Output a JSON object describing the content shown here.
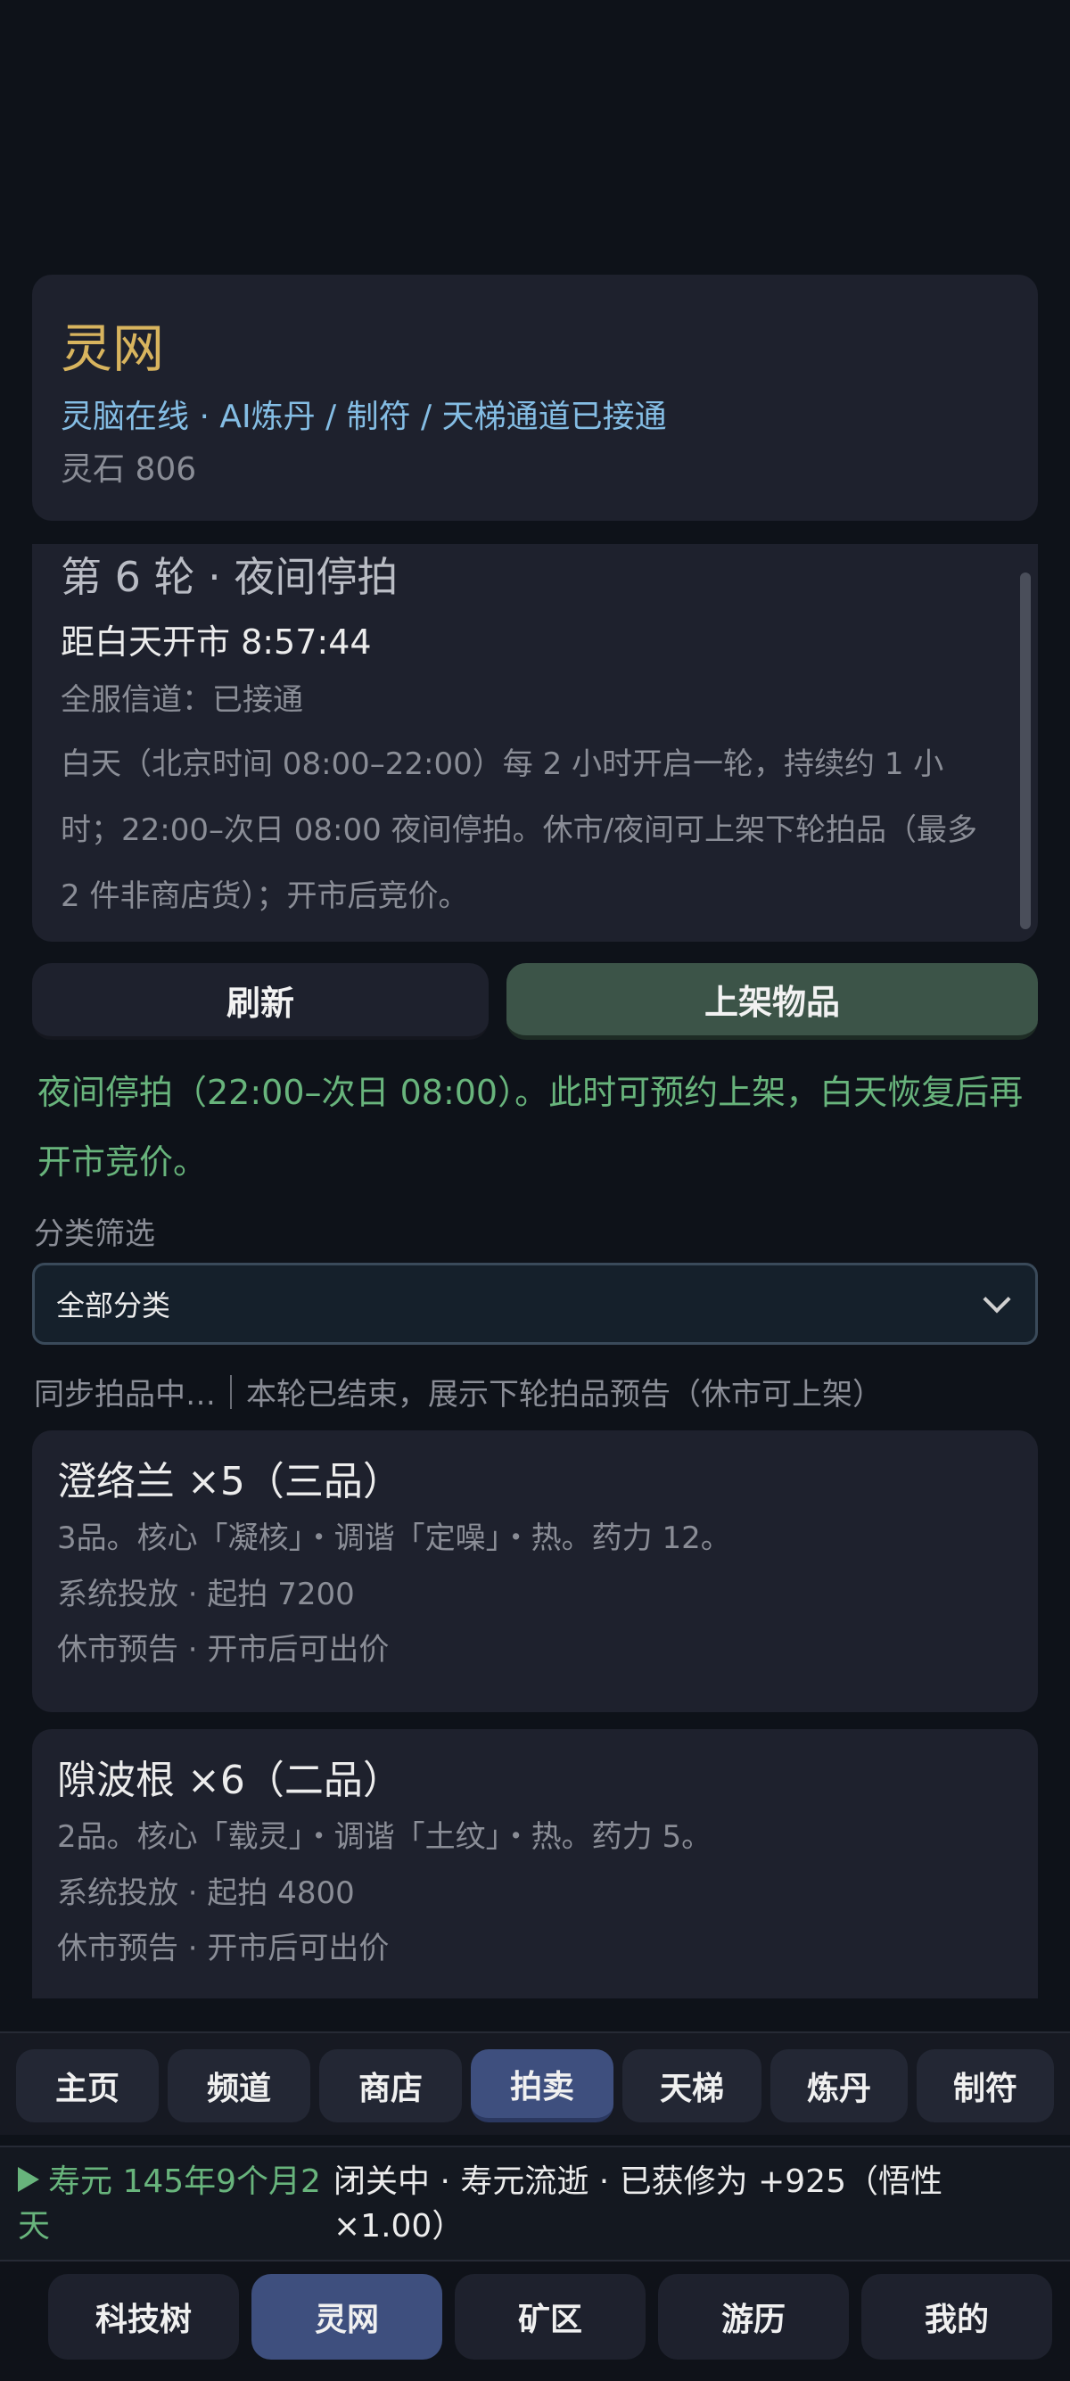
{
  "header": {
    "title": "灵网",
    "subtitle": "灵脑在线 · AI炼丹 / 制符 / 天梯通道已接通",
    "spirit_stone": "灵石 806"
  },
  "round": {
    "title": "第 6 轮 · 夜间停拍",
    "countdown": "距白天开市 8:57:44",
    "channel": "全服信道：已接通",
    "description": "白天（北京时间 08:00–22:00）每 2 小时开启一轮，持续约 1 小时；22:00–次日 08:00 夜间停拍。休市/夜间可上架下轮拍品（最多 2 件非商店货）；开市后竞价。"
  },
  "actions": {
    "refresh": "刷新",
    "list_item": "上架物品"
  },
  "notice": "夜间停拍（22:00–次日 08:00）。此时可预约上架，白天恢复后再开市竞价。",
  "filter": {
    "label": "分类筛选",
    "selected": "全部分类"
  },
  "status": {
    "syncing": "同步拍品中…",
    "info": "本轮已结束，展示下轮拍品预告（休市可上架）"
  },
  "items": [
    {
      "name": "澄络兰 ×5（三品）",
      "desc": "3品。核心「凝核」・调谐「定噪」・热。药力 12。",
      "source": "系统投放 · 起拍 7200",
      "state": "休市预告 · 开市后可出价"
    },
    {
      "name": "隙波根 ×6（二品）",
      "desc": "2品。核心「载灵」・调谐「土纹」・热。药力 5。",
      "source": "系统投放 · 起拍 4800",
      "state": "休市预告 · 开市后可出价"
    }
  ],
  "sub_nav": {
    "tabs": [
      "主页",
      "频道",
      "商店",
      "拍卖",
      "天梯",
      "炼丹",
      "制符"
    ],
    "active": "拍卖"
  },
  "statusbar": {
    "lifespan": "寿元 145年9个月2天",
    "seclusion": "闭关中 · 寿元流逝 · 已获修为 +925（悟性×1.00）"
  },
  "main_nav": {
    "tabs": [
      "科技树",
      "灵网",
      "矿区",
      "游历",
      "我的"
    ],
    "active": "灵网"
  },
  "colors": {
    "background": "#0e1219",
    "card": "#1e212d",
    "title_gold": "#d8b45e",
    "link_blue": "#84bde4",
    "notice_green": "#68b47c",
    "active_tab": "#3e4f7e",
    "primary_button": "#3c5448"
  }
}
